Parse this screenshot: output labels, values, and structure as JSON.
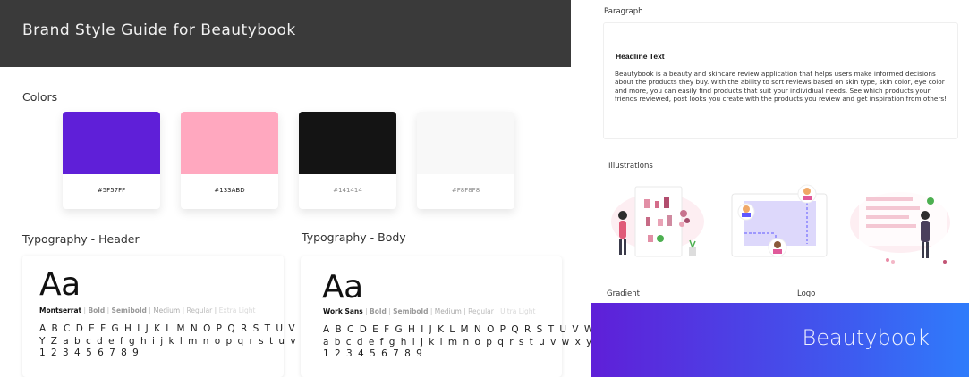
{
  "header": {
    "title": "Brand Style Guide for Beautybook"
  },
  "colors": {
    "label": "Colors",
    "swatches": [
      {
        "hex": "#5F1FD8",
        "code": "#5F57FF",
        "code_color": "#222"
      },
      {
        "hex": "#FFA8BF",
        "code": "#133ABD",
        "code_color": "#222"
      },
      {
        "hex": "#141414",
        "code": "#141414",
        "code_color": "#888"
      },
      {
        "hex": "#F8F8F8",
        "code": "#F8F8F8",
        "code_color": "#888"
      }
    ]
  },
  "typography_header": {
    "label": "Typography - Header",
    "sample": "Aa",
    "font_name": "Montserrat",
    "weights": {
      "bold": "Bold",
      "semibold": "Semibold",
      "medium": "Medium",
      "regular": "Regular",
      "light": "Extra Light"
    },
    "alphabet_lines": [
      "A B C D E F G H I J K L M N O P Q R S T U V W X",
      "Y Z a b c d e f g h i j k l m n o p q r s t u v w x y z",
      "1 2 3 4 5 6 7 8 9"
    ]
  },
  "typography_body": {
    "label": "Typography - Body",
    "sample": "Aa",
    "font_name": "Work Sans",
    "weights": {
      "bold": "Bold",
      "semibold": "Semibold",
      "medium": "Medium",
      "regular": "Regular",
      "light": "Ultra Light"
    },
    "alphabet_lines": [
      "A B C D E F G H I J K L M N O P Q R S T U V W X Y Z",
      "a b c d e f g h i j k l m n o p q r s t u v w x y z",
      "1 2 3 4 5 6 7 8 9"
    ]
  },
  "paragraph": {
    "label": "Paragraph",
    "headline": "Headline Text",
    "body": "Beautybook is a beauty and skincare review application that helps users make informed decisions about the products they buy. With the ability to sort reviews based on skin type, skin color, eye color and more, you can easily find products that suit your individiual needs. See which products your friends reviewed, post looks you create with the products you review and get inspiration from others!"
  },
  "illustrations": {
    "label": "Illustrations"
  },
  "gradient": {
    "label": "Gradient",
    "start": "#5F1FD8",
    "end": "#2F7CFB"
  },
  "logo": {
    "label": "Logo",
    "text": "Beautybook"
  }
}
